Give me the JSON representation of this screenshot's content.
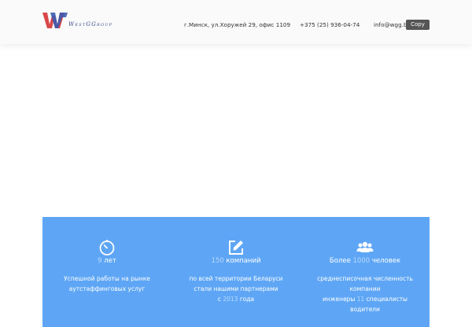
{
  "header": {
    "logo": {
      "text": "WestGGroup"
    },
    "address": "г.Минск, ул.Хоружей 29, офис 1109",
    "phone": "+375 (25) 936-04-74",
    "email": "info@wgg.by",
    "copy_label": "Copy"
  },
  "stats": [
    {
      "icon": "clock-icon",
      "number": "9",
      "title_suffix": " лет",
      "desc_lines": [
        "Успешной работы на рынке",
        "аутстаффинговых услуг"
      ]
    },
    {
      "icon": "edit-icon",
      "number": "150",
      "title_suffix": " компаний",
      "desc_lines": [
        "по всей территории Беларуси",
        "стали нашими партнерами"
      ],
      "desc_year_prefix": "с ",
      "desc_year": "2013",
      "desc_year_suffix": " года"
    },
    {
      "icon": "users-icon",
      "title_prefix": "Более ",
      "number": "1000",
      "title_suffix": " человек",
      "desc_lines": [
        "среднесписочная численность",
        "компании"
      ],
      "desc_line3_prefix": "инженеры ",
      "desc_line3_num": "11",
      "desc_line3_suffix": " специалисты",
      "desc_line4": "водители"
    }
  ],
  "colors": {
    "stats_bg": "#5ea6f5",
    "header_bg": "#fafafa",
    "copy_button": "#555555"
  }
}
